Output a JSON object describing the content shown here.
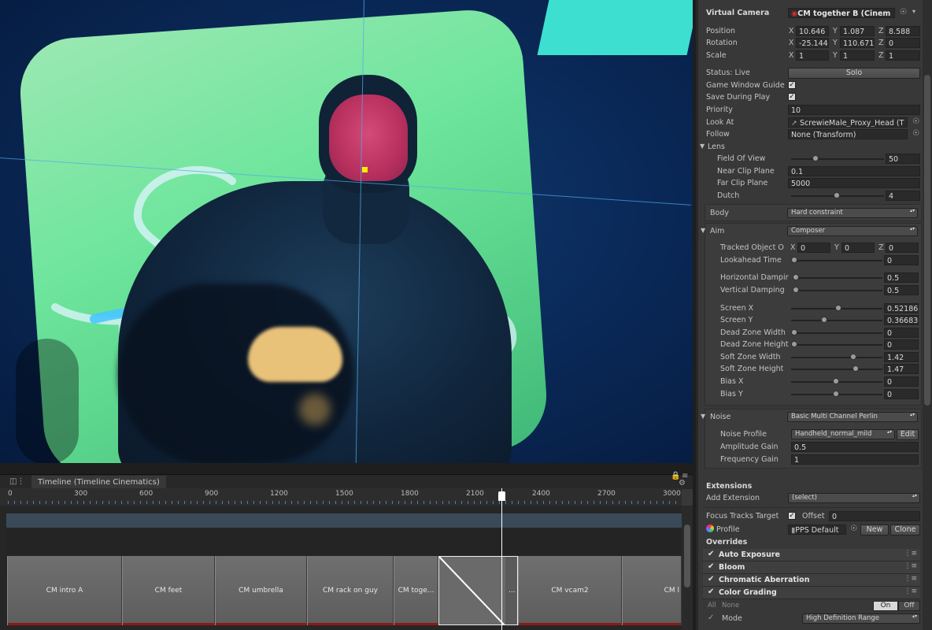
{
  "timeline": {
    "tab_title": "Timeline (Timeline Cinematics)",
    "ruler": [
      "0",
      "300",
      "600",
      "900",
      "1200",
      "1500",
      "1800",
      "2100",
      "2400",
      "2700",
      "3000"
    ],
    "clips": [
      "CM intro A",
      "CM feet",
      "CM umbrella",
      "CM rack on guy",
      "CM toge...",
      "...",
      "CM vcam2",
      "CM l"
    ]
  },
  "inspector": {
    "virtual_camera_label": "Virtual Camera",
    "virtual_camera_value": "CM together B (Cinem",
    "position_label": "Position",
    "rotation_label": "Rotation",
    "scale_label": "Scale",
    "position": {
      "x": "10.646",
      "y": "1.087",
      "z": "8.588"
    },
    "rotation": {
      "x": "-25.144",
      "y": "110.671",
      "z": "0"
    },
    "scale": {
      "x": "1",
      "y": "1",
      "z": "1"
    },
    "axis_x": "X",
    "axis_y": "Y",
    "axis_z": "Z",
    "status_label": "Status: Live",
    "solo_label": "Solo",
    "game_window_guides_label": "Game Window Guide",
    "save_during_play_label": "Save During Play",
    "priority_label": "Priority",
    "priority_value": "10",
    "look_at_label": "Look At",
    "look_at_value": "ScrewieMale_Proxy_Head (T",
    "follow_label": "Follow",
    "follow_value": "None (Transform)",
    "lens_label": "Lens",
    "fov_label": "Field Of View",
    "fov_value": "50",
    "near_clip_label": "Near Clip Plane",
    "near_clip_value": "0.1",
    "far_clip_label": "Far Clip Plane",
    "far_clip_value": "5000",
    "dutch_label": "Dutch",
    "dutch_value": "4",
    "body_label": "Body",
    "body_value": "Hard constraint",
    "aim_label": "Aim",
    "aim_value": "Composer",
    "tracked_offset_label": "Tracked Object O",
    "tracked_offset": {
      "x": "0",
      "y": "0",
      "z": "0"
    },
    "lookahead_time_label": "Lookahead Time",
    "lookahead_time_value": "0",
    "horizontal_damping_label": "Horizontal Dampir",
    "horizontal_damping_value": "0.5",
    "vertical_damping_label": "Vertical Damping",
    "vertical_damping_value": "0.5",
    "screen_x_label": "Screen X",
    "screen_x_value": "0.52186",
    "screen_y_label": "Screen Y",
    "screen_y_value": "0.36683",
    "dead_zone_width_label": "Dead Zone Width",
    "dead_zone_width_value": "0",
    "dead_zone_height_label": "Dead Zone Height",
    "dead_zone_height_value": "0",
    "soft_zone_width_label": "Soft Zone Width",
    "soft_zone_width_value": "1.42",
    "soft_zone_height_label": "Soft Zone Height",
    "soft_zone_height_value": "1.47",
    "bias_x_label": "Bias X",
    "bias_x_value": "0",
    "bias_y_label": "Bias Y",
    "bias_y_value": "0",
    "noise_label": "Noise",
    "noise_value": "Basic Multi Channel Perlin",
    "noise_profile_label": "Noise Profile",
    "noise_profile_value": "Handheld_normal_mild",
    "edit_label": "Edit",
    "amplitude_gain_label": "Amplitude Gain",
    "amplitude_gain_value": "0.5",
    "frequency_gain_label": "Frequency Gain",
    "frequency_gain_value": "1",
    "extensions_label": "Extensions",
    "add_extension_label": "Add Extension",
    "add_extension_value": "(select)",
    "focus_tracks_label": "Focus Tracks Target",
    "offset_label": "Offset",
    "offset_value": "0",
    "profile_label": "Profile",
    "profile_value": "PPS Default",
    "new_label": "New",
    "clone_label": "Clone",
    "overrides_label": "Overrides",
    "overrides": [
      "Auto Exposure",
      "Bloom",
      "Chromatic Aberration",
      "Color Grading"
    ],
    "all_label": "All",
    "none_label": "None",
    "on_label": "On",
    "off_label": "Off",
    "mode_label": "Mode",
    "mode_value": "High Definition Range"
  },
  "colors": {
    "guide_lines": "#50aae6",
    "target_marker": "#ffee00",
    "clip_bar": "#8b1a1a",
    "ruler_minor_ticks": "#4f7db8"
  },
  "icons": [
    "lock-icon",
    "menu-icon",
    "gear-icon",
    "timeline-icon",
    "target-icon",
    "checkmark-icon",
    "fold-arrow-icon",
    "transform-icon",
    "postprocess-profile-icon"
  ]
}
